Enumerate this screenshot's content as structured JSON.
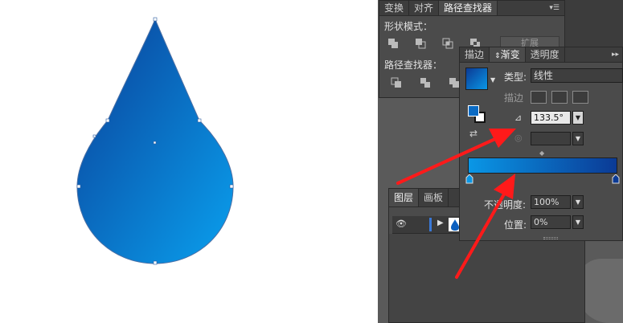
{
  "pathfinder_panel": {
    "tabs": [
      "变换",
      "对齐",
      "路径查找器"
    ],
    "active_tab": "路径查找器",
    "shape_modes_label": "形状模式：",
    "expand_label": "扩展",
    "pathfinders_label": "路径查找器："
  },
  "gradient_panel": {
    "tabs": [
      "描边",
      "渐变",
      "透明度"
    ],
    "active_tab": "渐变",
    "type_label": "类型:",
    "type_value": "线性",
    "stroke_label": "描边",
    "angle_value": "133.5°",
    "gradient_start_color": "#0a97e6",
    "gradient_end_color": "#0b3a95",
    "opacity_label": "不透明度:",
    "opacity_value": "100%",
    "location_label": "位置:",
    "location_value": "0%"
  },
  "layers_panel": {
    "tabs": [
      "图层",
      "画板"
    ],
    "active_tab": "图层"
  },
  "drop_shape": {
    "fill_light": "#0aa0ee",
    "fill_dark": "#0a3f98"
  },
  "annotation": {
    "arrow_color": "#ff1a1a"
  }
}
